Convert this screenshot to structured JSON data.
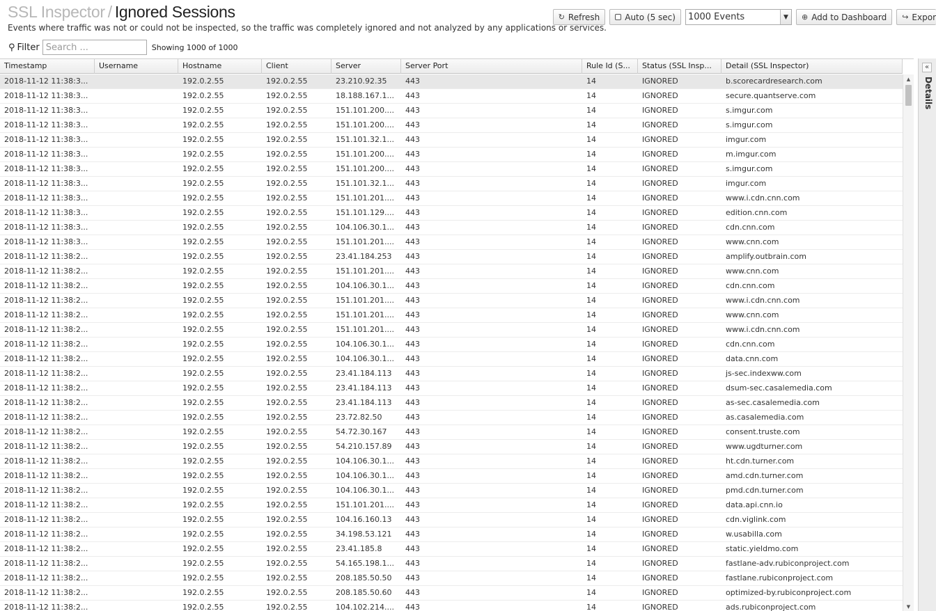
{
  "header": {
    "crumb": "SSL Inspector",
    "separator": "/",
    "title": "Ignored Sessions",
    "subtitle": "Events where traffic was not or could not be inspected, so the traffic was completely ignored and not analyzed by any applications or services."
  },
  "toolbar": {
    "refresh_label": "Refresh",
    "auto_label": "Auto (5 sec)",
    "events_select": "1000 Events",
    "add_dashboard_label": "Add to Dashboard",
    "export_label": "Expor"
  },
  "filter": {
    "label": "Filter",
    "placeholder": "Search ...",
    "showing": "Showing 1000 of 1000"
  },
  "columns": [
    "Timestamp",
    "Username",
    "Hostname",
    "Client",
    "Server",
    "Server Port",
    "Rule Id (S...",
    "Status (SSL Insp...",
    "Detail (SSL Inspector)"
  ],
  "rows": [
    [
      "2018-11-12 11:38:3...",
      "",
      "192.0.2.55",
      "192.0.2.55",
      "23.210.92.35",
      "443",
      "14",
      "IGNORED",
      "b.scorecardresearch.com"
    ],
    [
      "2018-11-12 11:38:3...",
      "",
      "192.0.2.55",
      "192.0.2.55",
      "18.188.167.1...",
      "443",
      "14",
      "IGNORED",
      "secure.quantserve.com"
    ],
    [
      "2018-11-12 11:38:3...",
      "",
      "192.0.2.55",
      "192.0.2.55",
      "151.101.200....",
      "443",
      "14",
      "IGNORED",
      "s.imgur.com"
    ],
    [
      "2018-11-12 11:38:3...",
      "",
      "192.0.2.55",
      "192.0.2.55",
      "151.101.200....",
      "443",
      "14",
      "IGNORED",
      "s.imgur.com"
    ],
    [
      "2018-11-12 11:38:3...",
      "",
      "192.0.2.55",
      "192.0.2.55",
      "151.101.32.1...",
      "443",
      "14",
      "IGNORED",
      "imgur.com"
    ],
    [
      "2018-11-12 11:38:3...",
      "",
      "192.0.2.55",
      "192.0.2.55",
      "151.101.200....",
      "443",
      "14",
      "IGNORED",
      "m.imgur.com"
    ],
    [
      "2018-11-12 11:38:3...",
      "",
      "192.0.2.55",
      "192.0.2.55",
      "151.101.200....",
      "443",
      "14",
      "IGNORED",
      "s.imgur.com"
    ],
    [
      "2018-11-12 11:38:3...",
      "",
      "192.0.2.55",
      "192.0.2.55",
      "151.101.32.1...",
      "443",
      "14",
      "IGNORED",
      "imgur.com"
    ],
    [
      "2018-11-12 11:38:3...",
      "",
      "192.0.2.55",
      "192.0.2.55",
      "151.101.201....",
      "443",
      "14",
      "IGNORED",
      "www.i.cdn.cnn.com"
    ],
    [
      "2018-11-12 11:38:3...",
      "",
      "192.0.2.55",
      "192.0.2.55",
      "151.101.129....",
      "443",
      "14",
      "IGNORED",
      "edition.cnn.com"
    ],
    [
      "2018-11-12 11:38:3...",
      "",
      "192.0.2.55",
      "192.0.2.55",
      "104.106.30.1...",
      "443",
      "14",
      "IGNORED",
      "cdn.cnn.com"
    ],
    [
      "2018-11-12 11:38:3...",
      "",
      "192.0.2.55",
      "192.0.2.55",
      "151.101.201....",
      "443",
      "14",
      "IGNORED",
      "www.cnn.com"
    ],
    [
      "2018-11-12 11:38:2...",
      "",
      "192.0.2.55",
      "192.0.2.55",
      "23.41.184.253",
      "443",
      "14",
      "IGNORED",
      "amplify.outbrain.com"
    ],
    [
      "2018-11-12 11:38:2...",
      "",
      "192.0.2.55",
      "192.0.2.55",
      "151.101.201....",
      "443",
      "14",
      "IGNORED",
      "www.cnn.com"
    ],
    [
      "2018-11-12 11:38:2...",
      "",
      "192.0.2.55",
      "192.0.2.55",
      "104.106.30.1...",
      "443",
      "14",
      "IGNORED",
      "cdn.cnn.com"
    ],
    [
      "2018-11-12 11:38:2...",
      "",
      "192.0.2.55",
      "192.0.2.55",
      "151.101.201....",
      "443",
      "14",
      "IGNORED",
      "www.i.cdn.cnn.com"
    ],
    [
      "2018-11-12 11:38:2...",
      "",
      "192.0.2.55",
      "192.0.2.55",
      "151.101.201....",
      "443",
      "14",
      "IGNORED",
      "www.cnn.com"
    ],
    [
      "2018-11-12 11:38:2...",
      "",
      "192.0.2.55",
      "192.0.2.55",
      "151.101.201....",
      "443",
      "14",
      "IGNORED",
      "www.i.cdn.cnn.com"
    ],
    [
      "2018-11-12 11:38:2...",
      "",
      "192.0.2.55",
      "192.0.2.55",
      "104.106.30.1...",
      "443",
      "14",
      "IGNORED",
      "cdn.cnn.com"
    ],
    [
      "2018-11-12 11:38:2...",
      "",
      "192.0.2.55",
      "192.0.2.55",
      "104.106.30.1...",
      "443",
      "14",
      "IGNORED",
      "data.cnn.com"
    ],
    [
      "2018-11-12 11:38:2...",
      "",
      "192.0.2.55",
      "192.0.2.55",
      "23.41.184.113",
      "443",
      "14",
      "IGNORED",
      "js-sec.indexww.com"
    ],
    [
      "2018-11-12 11:38:2...",
      "",
      "192.0.2.55",
      "192.0.2.55",
      "23.41.184.113",
      "443",
      "14",
      "IGNORED",
      "dsum-sec.casalemedia.com"
    ],
    [
      "2018-11-12 11:38:2...",
      "",
      "192.0.2.55",
      "192.0.2.55",
      "23.41.184.113",
      "443",
      "14",
      "IGNORED",
      "as-sec.casalemedia.com"
    ],
    [
      "2018-11-12 11:38:2...",
      "",
      "192.0.2.55",
      "192.0.2.55",
      "23.72.82.50",
      "443",
      "14",
      "IGNORED",
      "as.casalemedia.com"
    ],
    [
      "2018-11-12 11:38:2...",
      "",
      "192.0.2.55",
      "192.0.2.55",
      "54.72.30.167",
      "443",
      "14",
      "IGNORED",
      "consent.truste.com"
    ],
    [
      "2018-11-12 11:38:2...",
      "",
      "192.0.2.55",
      "192.0.2.55",
      "54.210.157.89",
      "443",
      "14",
      "IGNORED",
      "www.ugdturner.com"
    ],
    [
      "2018-11-12 11:38:2...",
      "",
      "192.0.2.55",
      "192.0.2.55",
      "104.106.30.1...",
      "443",
      "14",
      "IGNORED",
      "ht.cdn.turner.com"
    ],
    [
      "2018-11-12 11:38:2...",
      "",
      "192.0.2.55",
      "192.0.2.55",
      "104.106.30.1...",
      "443",
      "14",
      "IGNORED",
      "amd.cdn.turner.com"
    ],
    [
      "2018-11-12 11:38:2...",
      "",
      "192.0.2.55",
      "192.0.2.55",
      "104.106.30.1...",
      "443",
      "14",
      "IGNORED",
      "pmd.cdn.turner.com"
    ],
    [
      "2018-11-12 11:38:2...",
      "",
      "192.0.2.55",
      "192.0.2.55",
      "151.101.201....",
      "443",
      "14",
      "IGNORED",
      "data.api.cnn.io"
    ],
    [
      "2018-11-12 11:38:2...",
      "",
      "192.0.2.55",
      "192.0.2.55",
      "104.16.160.13",
      "443",
      "14",
      "IGNORED",
      "cdn.viglink.com"
    ],
    [
      "2018-11-12 11:38:2...",
      "",
      "192.0.2.55",
      "192.0.2.55",
      "34.198.53.121",
      "443",
      "14",
      "IGNORED",
      "w.usabilla.com"
    ],
    [
      "2018-11-12 11:38:2...",
      "",
      "192.0.2.55",
      "192.0.2.55",
      "23.41.185.8",
      "443",
      "14",
      "IGNORED",
      "static.yieldmo.com"
    ],
    [
      "2018-11-12 11:38:2...",
      "",
      "192.0.2.55",
      "192.0.2.55",
      "54.165.198.1...",
      "443",
      "14",
      "IGNORED",
      "fastlane-adv.rubiconproject.com"
    ],
    [
      "2018-11-12 11:38:2...",
      "",
      "192.0.2.55",
      "192.0.2.55",
      "208.185.50.50",
      "443",
      "14",
      "IGNORED",
      "fastlane.rubiconproject.com"
    ],
    [
      "2018-11-12 11:38:2...",
      "",
      "192.0.2.55",
      "192.0.2.55",
      "208.185.50.60",
      "443",
      "14",
      "IGNORED",
      "optimized-by.rubiconproject.com"
    ],
    [
      "2018-11-12 11:38:2...",
      "",
      "192.0.2.55",
      "192.0.2.55",
      "104.102.214....",
      "443",
      "14",
      "IGNORED",
      "ads.rubiconproject.com"
    ]
  ],
  "details_panel": {
    "label": "Details"
  },
  "icons": {
    "refresh": "refresh-icon",
    "checkbox": "checkbox-icon",
    "add": "plus-circle-icon",
    "export": "export-icon",
    "search": "search-icon",
    "collapse": "double-chevron-left-icon"
  }
}
